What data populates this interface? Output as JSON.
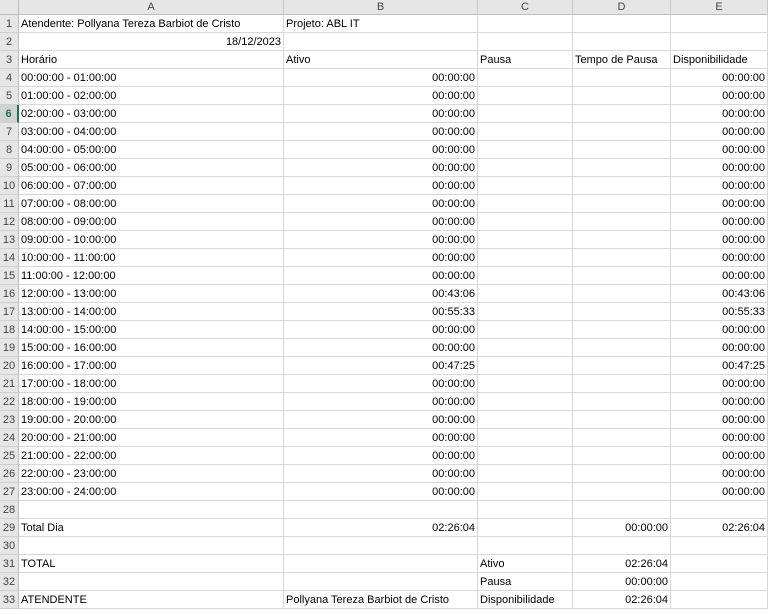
{
  "columns": [
    "A",
    "B",
    "C",
    "D",
    "E"
  ],
  "selected_row": 6,
  "rows": [
    {
      "n": "1",
      "a": "Atendente: Pollyana Tereza Barbiot de Cristo",
      "b": "Projeto: ABL IT",
      "c": "",
      "d": "",
      "e": ""
    },
    {
      "n": "2",
      "a": "18/12/2023",
      "b": "",
      "c": "",
      "d": "",
      "e": ""
    },
    {
      "n": "3",
      "a": "Horário",
      "b": "Ativo",
      "c": "Pausa",
      "d": "Tempo de Pausa",
      "e": "Disponibilidade"
    },
    {
      "n": "4",
      "a": "00:00:00 - 01:00:00",
      "b": "00:00:00",
      "c": "",
      "d": "",
      "e": "00:00:00"
    },
    {
      "n": "5",
      "a": "01:00:00 - 02:00:00",
      "b": "00:00:00",
      "c": "",
      "d": "",
      "e": "00:00:00"
    },
    {
      "n": "6",
      "a": "02:00:00 - 03:00:00",
      "b": "00:00:00",
      "c": "",
      "d": "",
      "e": "00:00:00"
    },
    {
      "n": "7",
      "a": "03:00:00 - 04:00:00",
      "b": "00:00:00",
      "c": "",
      "d": "",
      "e": "00:00:00"
    },
    {
      "n": "8",
      "a": "04:00:00 - 05:00:00",
      "b": "00:00:00",
      "c": "",
      "d": "",
      "e": "00:00:00"
    },
    {
      "n": "9",
      "a": "05:00:00 - 06:00:00",
      "b": "00:00:00",
      "c": "",
      "d": "",
      "e": "00:00:00"
    },
    {
      "n": "10",
      "a": "06:00:00 - 07:00:00",
      "b": "00:00:00",
      "c": "",
      "d": "",
      "e": "00:00:00"
    },
    {
      "n": "11",
      "a": "07:00:00 - 08:00:00",
      "b": "00:00:00",
      "c": "",
      "d": "",
      "e": "00:00:00"
    },
    {
      "n": "12",
      "a": "08:00:00 - 09:00:00",
      "b": "00:00:00",
      "c": "",
      "d": "",
      "e": "00:00:00"
    },
    {
      "n": "13",
      "a": "09:00:00 - 10:00:00",
      "b": "00:00:00",
      "c": "",
      "d": "",
      "e": "00:00:00"
    },
    {
      "n": "14",
      "a": "10:00:00 - 11:00:00",
      "b": "00:00:00",
      "c": "",
      "d": "",
      "e": "00:00:00"
    },
    {
      "n": "15",
      "a": "11:00:00 - 12:00:00",
      "b": "00:00:00",
      "c": "",
      "d": "",
      "e": "00:00:00"
    },
    {
      "n": "16",
      "a": "12:00:00 - 13:00:00",
      "b": "00:43:06",
      "c": "",
      "d": "",
      "e": "00:43:06"
    },
    {
      "n": "17",
      "a": "13:00:00 - 14:00:00",
      "b": "00:55:33",
      "c": "",
      "d": "",
      "e": "00:55:33"
    },
    {
      "n": "18",
      "a": "14:00:00 - 15:00:00",
      "b": "00:00:00",
      "c": "",
      "d": "",
      "e": "00:00:00"
    },
    {
      "n": "19",
      "a": "15:00:00 - 16:00:00",
      "b": "00:00:00",
      "c": "",
      "d": "",
      "e": "00:00:00"
    },
    {
      "n": "20",
      "a": "16:00:00 - 17:00:00",
      "b": "00:47:25",
      "c": "",
      "d": "",
      "e": "00:47:25"
    },
    {
      "n": "21",
      "a": "17:00:00 - 18:00:00",
      "b": "00:00:00",
      "c": "",
      "d": "",
      "e": "00:00:00"
    },
    {
      "n": "22",
      "a": "18:00:00 - 19:00:00",
      "b": "00:00:00",
      "c": "",
      "d": "",
      "e": "00:00:00"
    },
    {
      "n": "23",
      "a": "19:00:00 - 20:00:00",
      "b": "00:00:00",
      "c": "",
      "d": "",
      "e": "00:00:00"
    },
    {
      "n": "24",
      "a": "20:00:00 - 21:00:00",
      "b": "00:00:00",
      "c": "",
      "d": "",
      "e": "00:00:00"
    },
    {
      "n": "25",
      "a": "21:00:00 - 22:00:00",
      "b": "00:00:00",
      "c": "",
      "d": "",
      "e": "00:00:00"
    },
    {
      "n": "26",
      "a": "22:00:00 - 23:00:00",
      "b": "00:00:00",
      "c": "",
      "d": "",
      "e": "00:00:00"
    },
    {
      "n": "27",
      "a": "23:00:00 - 24:00:00",
      "b": "00:00:00",
      "c": "",
      "d": "",
      "e": "00:00:00"
    },
    {
      "n": "28",
      "a": "",
      "b": "",
      "c": "",
      "d": "",
      "e": ""
    },
    {
      "n": "29",
      "a": "Total Dia",
      "b": "02:26:04",
      "c": "",
      "d": "00:00:00",
      "e": "02:26:04"
    },
    {
      "n": "30",
      "a": "",
      "b": "",
      "c": "",
      "d": "",
      "e": ""
    },
    {
      "n": "31",
      "a": "TOTAL",
      "b": "",
      "c": "Ativo",
      "d": "02:26:04",
      "e": ""
    },
    {
      "n": "32",
      "a": "",
      "b": "",
      "c": "Pausa",
      "d": "00:00:00",
      "e": ""
    },
    {
      "n": "33",
      "a": "ATENDENTE",
      "b": "Pollyana Tereza Barbiot de Cristo",
      "c": "Disponibilidade",
      "d": "02:26:04",
      "e": ""
    }
  ]
}
